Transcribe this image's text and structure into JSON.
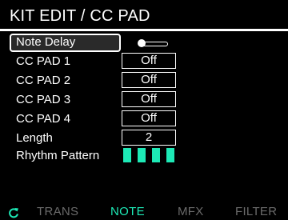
{
  "header": {
    "title": "KIT EDIT / CC PAD"
  },
  "params": {
    "note_delay": {
      "label": "Note Delay",
      "toggle_state": "off"
    },
    "cc_pad_1": {
      "label": "CC PAD 1",
      "value": "Off"
    },
    "cc_pad_2": {
      "label": "CC PAD 2",
      "value": "Off"
    },
    "cc_pad_3": {
      "label": "CC PAD 3",
      "value": "Off"
    },
    "cc_pad_4": {
      "label": "CC PAD 4",
      "value": "Off"
    },
    "length": {
      "label": "Length",
      "value": "2"
    },
    "rhythm_pattern": {
      "label": "Rhythm Pattern",
      "steps_active": 4
    }
  },
  "tabs": [
    {
      "label": "TRANS",
      "active": false
    },
    {
      "label": "NOTE",
      "active": true
    },
    {
      "label": "MFX",
      "active": false
    },
    {
      "label": "FILTER",
      "active": false
    }
  ],
  "icons": {
    "bottom_left": "refresh-icon"
  },
  "colors": {
    "accent": "#1de9b6",
    "inactive_tab": "#6a6a6a",
    "background": "#000000",
    "text": "#ffffff"
  }
}
